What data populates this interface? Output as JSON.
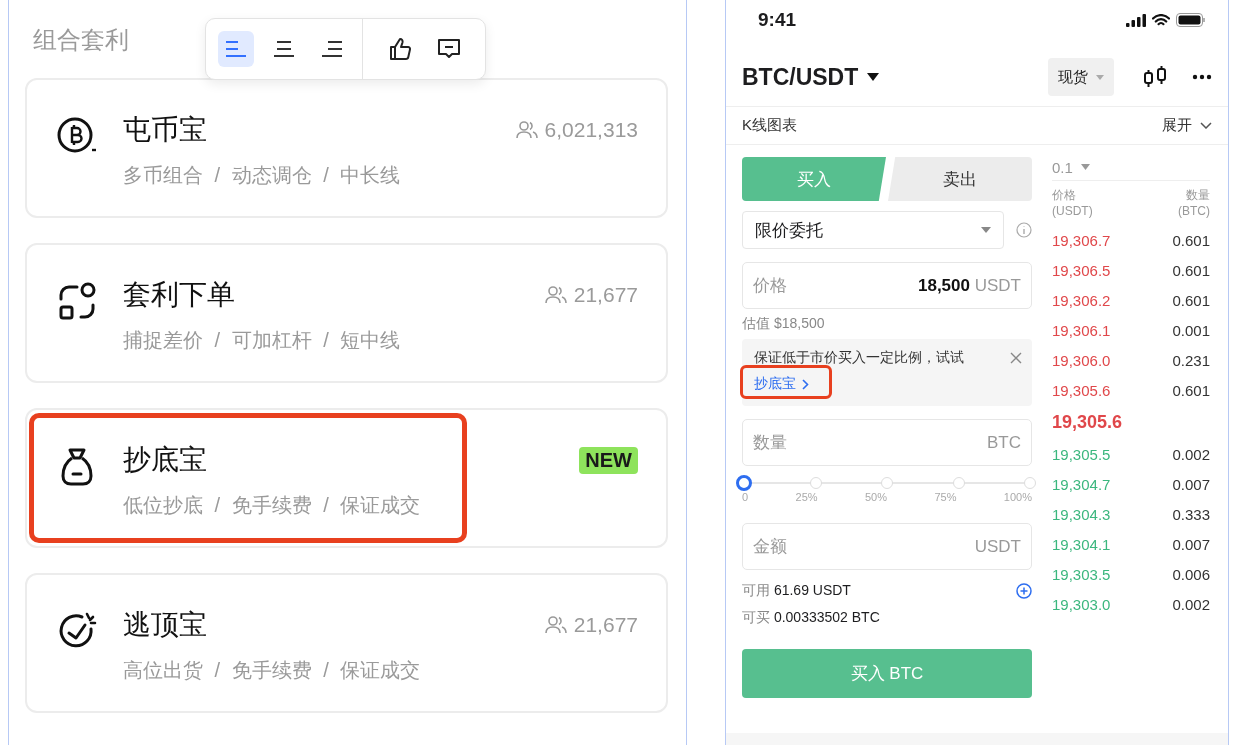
{
  "left_panel": {
    "title": "组合套利",
    "toolbar": {
      "align_buttons": [
        {
          "kind": "left",
          "selected": true
        },
        {
          "kind": "center",
          "selected": false
        },
        {
          "kind": "right",
          "selected": false
        }
      ],
      "actions": [
        {
          "kind": "thumbs-up"
        },
        {
          "kind": "comment"
        }
      ]
    },
    "products": [
      {
        "kind": "bitcoin",
        "name": "屯币宝",
        "users": "6,021,313",
        "tags": "多币组合 / 动态调仓 / 中长线",
        "highlighted": false
      },
      {
        "kind": "swap",
        "name": "套利下单",
        "users": "21,677",
        "tags": "捕捉差价 / 可加杠杆 / 短中线",
        "highlighted": false
      },
      {
        "kind": "bag",
        "name": "抄底宝",
        "badge": "NEW",
        "tags": "低位抄底 / 免手续费 / 保证成交",
        "highlighted": true
      },
      {
        "kind": "timer",
        "name": "逃顶宝",
        "users": "21,677",
        "tags": "高位出货 / 免手续费 / 保证成交",
        "highlighted": false
      }
    ]
  },
  "phone": {
    "status_bar": {
      "time": "9:41"
    },
    "header": {
      "pair": "BTC/USDT",
      "market": "现货"
    },
    "chart_row": {
      "label": "K线图表",
      "toggle": "展开"
    },
    "side_tabs": [
      {
        "label": "买入",
        "selected": true
      },
      {
        "label": "卖出",
        "selected": false
      }
    ],
    "order_type": "限价委托",
    "price_field": {
      "label": "价格",
      "value": "18,500",
      "unit": "USDT"
    },
    "estimate": "估值 $18,500",
    "tip": {
      "text": "保证低于市价买入一定比例，试试",
      "link": "抄底宝",
      "highlighted": true
    },
    "quantity_field": {
      "placeholder": "数量",
      "unit": "BTC"
    },
    "slider": {
      "level": 0,
      "ticks": [
        "0",
        "25%",
        "50%",
        "75%",
        "100%"
      ]
    },
    "amount_field": {
      "placeholder": "金额",
      "unit": "USDT"
    },
    "available": {
      "label": "可用",
      "value": "61.69 USDT"
    },
    "can_buy": {
      "label": "可买",
      "value": "0.00333502 BTC"
    },
    "submit": "买入 BTC",
    "order_book": {
      "step": "0.1",
      "price_header": [
        "价格",
        "(USDT)"
      ],
      "amount_header": [
        "数量",
        "(BTC)"
      ],
      "asks": [
        {
          "price": "19,306.7",
          "amount": "0.601"
        },
        {
          "price": "19,306.5",
          "amount": "0.601"
        },
        {
          "price": "19,306.2",
          "amount": "0.601"
        },
        {
          "price": "19,306.1",
          "amount": "0.001"
        },
        {
          "price": "19,306.0",
          "amount": "0.231"
        },
        {
          "price": "19,305.6",
          "amount": "0.601"
        }
      ],
      "last_price": "19,305.6",
      "bids": [
        {
          "price": "19,305.5",
          "amount": "0.002"
        },
        {
          "price": "19,304.7",
          "amount": "0.007"
        },
        {
          "price": "19,304.3",
          "amount": "0.333"
        },
        {
          "price": "19,304.1",
          "amount": "0.007"
        },
        {
          "price": "19,303.5",
          "amount": "0.006"
        },
        {
          "price": "19,303.0",
          "amount": "0.002"
        }
      ]
    }
  }
}
